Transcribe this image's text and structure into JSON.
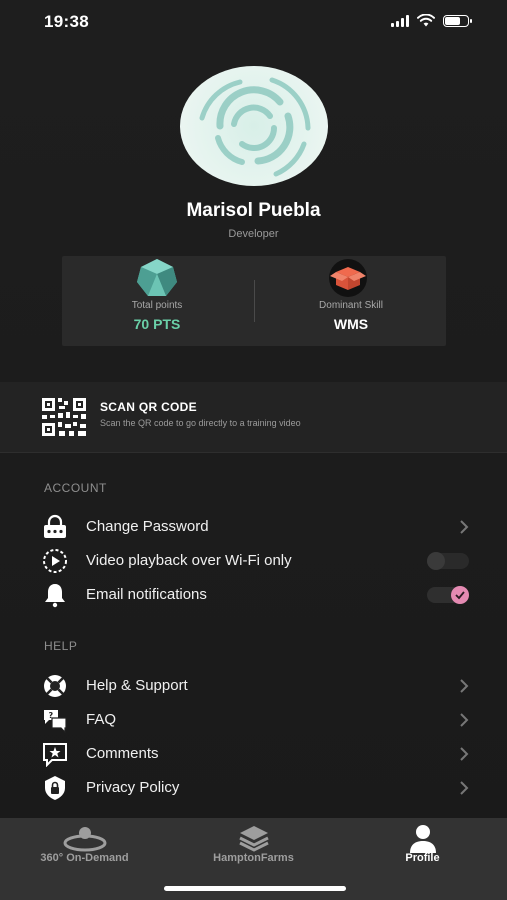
{
  "status_bar": {
    "time": "19:38"
  },
  "profile": {
    "name": "Marisol Puebla",
    "role": "Developer"
  },
  "stats": {
    "points_label": "Total points",
    "points_value": "70 PTS",
    "skill_label": "Dominant Skill",
    "skill_value": "WMS"
  },
  "scan": {
    "title": "SCAN QR CODE",
    "subtitle": "Scan the QR code to go directly to a training video"
  },
  "account": {
    "header": "ACCOUNT",
    "items": [
      {
        "label": "Change Password",
        "icon": "lock-icon"
      },
      {
        "label": "Video playback over Wi-Fi only",
        "icon": "play-icon",
        "toggle": "off"
      },
      {
        "label": "Email notifications",
        "icon": "bell-icon",
        "toggle": "on"
      }
    ]
  },
  "help": {
    "header": "HELP",
    "items": [
      {
        "label": "Help & Support",
        "icon": "lifebuoy-icon"
      },
      {
        "label": "FAQ",
        "icon": "chat-bubbles-icon"
      },
      {
        "label": "Comments",
        "icon": "star-message-icon"
      },
      {
        "label": "Privacy Policy",
        "icon": "shield-lock-icon"
      }
    ]
  },
  "tabs": [
    {
      "label": "360° On-Demand",
      "icon": "360-icon"
    },
    {
      "label": "HamptonFarms",
      "icon": "layers-icon"
    },
    {
      "label": "Profile",
      "icon": "person-icon",
      "active": true
    }
  ],
  "colors": {
    "accent_green": "#6ad0a8",
    "toggle_on": "#e48ab2",
    "skill_badge": "#e2573a"
  }
}
